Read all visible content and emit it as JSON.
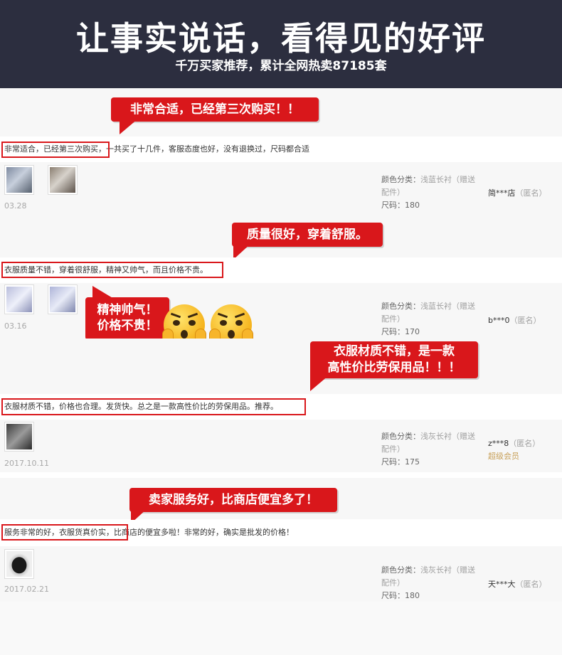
{
  "header": {
    "title": "让事实说话，看得见的好评",
    "subtitle": "千万买家推荐，累计全网热卖87185套"
  },
  "reviews": [
    {
      "bubble": "非常合适，已经第三次购买！！",
      "highlight": "非常适合，已经第三次购买",
      "text": "非常适合，已经第三次购买，一共买了十几件，客服态度也好，没有退换过，尺码都合适",
      "date": "03.28",
      "color_label": "颜色分类：",
      "color_value": "浅蓝长衬（赠送配件）",
      "size_label": "尺码：",
      "size_value": "180",
      "user": "简***店",
      "anon": "（匿名）"
    },
    {
      "bubble": "质量很好，穿着舒服。",
      "highlight": "衣服质量不错，穿着很舒服，精神又帅气，而且价格不贵。",
      "text": "衣服质量不错，穿着很舒服，精神又帅气，而且价格不贵。",
      "date": "03.16",
      "side_bubble": [
        "精神帅气！",
        "价格不贵！"
      ],
      "color_label": "颜色分类：",
      "color_value": "浅蓝长衬（赠送配件）",
      "size_label": "尺码：",
      "size_value": "170",
      "user": "b***0",
      "anon": "（匿名）"
    },
    {
      "bubble_lines": [
        "衣服材质不错，是一款",
        "高性价比劳保用品！！！"
      ],
      "highlight": "衣服材质不错，价格也合理。发货快。总之是一款高性价比的劳保用品。推荐。",
      "text": "衣服材质不错，价格也合理。发货快。总之是一款高性价比的劳保用品。推荐。",
      "date": "2017.10.11",
      "color_label": "颜色分类：",
      "color_value": "浅灰长衬（赠送配件）",
      "size_label": "尺码：",
      "size_value": "175",
      "user": "z***8",
      "anon": "（匿名）",
      "badge": "超级会员"
    },
    {
      "bubble": "卖家服务好，比商店便宜多了！",
      "highlight": "服务非常的好，衣服货真价实，",
      "text": "服务非常的好，衣服货真价实，比商店的便宜多啦！非常的好，确实是批发的价格！",
      "date": "2017.02.21",
      "color_label": "颜色分类：",
      "color_value": "浅灰长衬（赠送配件）",
      "size_label": "尺码：",
      "size_value": "180",
      "user": "天***大",
      "anon": "（匿名）"
    }
  ],
  "colors": {
    "header_bg": "#2c2e3f",
    "accent_red": "#d9171b",
    "vip_gold": "#c8a15a"
  }
}
